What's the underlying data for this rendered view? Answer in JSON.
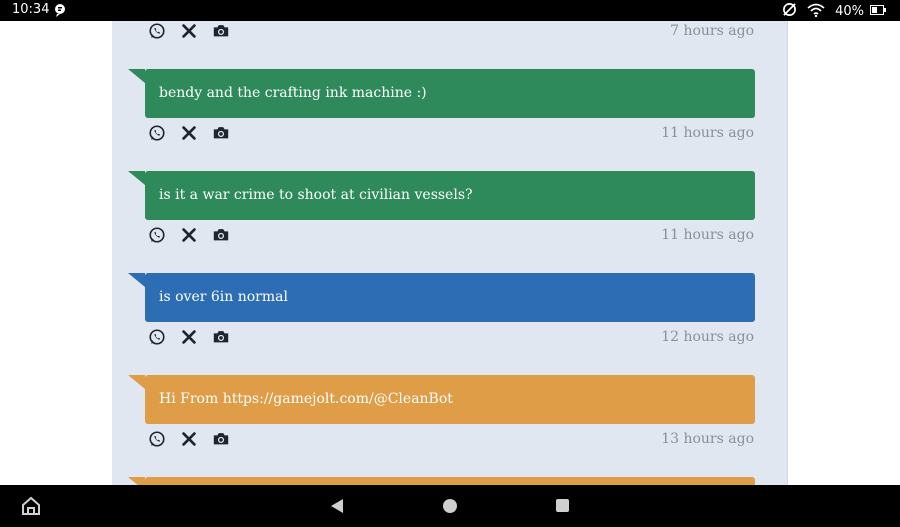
{
  "status_bar": {
    "time": "10:34",
    "battery": "40%",
    "icons": [
      "notification-icon",
      "do-not-disturb-icon",
      "wifi-icon",
      "battery-icon"
    ]
  },
  "colors": {
    "green": "#2e8a5a",
    "blue": "#2c6db3",
    "orange": "#e09d48",
    "panel": "#e1e7f1"
  },
  "messages": [
    {
      "text": "",
      "color": "green",
      "time": "7 hours ago"
    },
    {
      "text": "bendy and the crafting ink machine :)",
      "color": "green",
      "time": "11 hours ago"
    },
    {
      "text": "is it a war crime to shoot at civilian vessels?",
      "color": "green",
      "time": "11 hours ago"
    },
    {
      "text": "is over 6in normal",
      "color": "blue",
      "time": "12 hours ago"
    },
    {
      "text": "Hi From https://gamejolt.com/@CleanBot",
      "color": "orange",
      "time": "13 hours ago"
    },
    {
      "text": "",
      "color": "orange",
      "time": ""
    }
  ],
  "action_icons": [
    "whatsapp-icon",
    "close-icon",
    "camera-icon"
  ],
  "nav_bar": {
    "buttons": [
      "back-button",
      "home-button",
      "recents-button"
    ]
  }
}
